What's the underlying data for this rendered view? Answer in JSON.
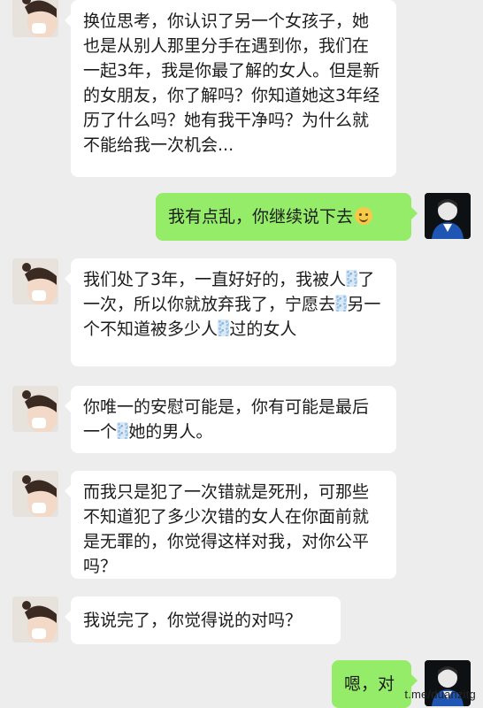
{
  "messages": [
    {
      "sender": "left",
      "segments": [
        "换位思考，你认识了另一个女孩子，她也是从别人那里分手在遇到你，我们在一起3年，我是你最了解的女人。但是新的女朋友，你了解吗？你知道她这3年经历了什么吗？她有我干净吗？为什么就不能给我一次机会..."
      ]
    },
    {
      "sender": "right",
      "segments": [
        "我有点乱，你继续说下去"
      ],
      "emoji": "smile-emoji"
    },
    {
      "sender": "left",
      "segments": [
        "我们处了3年，一直好好的，我被人",
        "了一次，所以你就放弃我了，宁愿去",
        "另一个不知道被多少人",
        "过的女人"
      ]
    },
    {
      "sender": "left",
      "segments": [
        "你唯一的安慰可能是，你有可能是最后一个",
        "她的男人。"
      ]
    },
    {
      "sender": "left",
      "segments": [
        "而我只是犯了一次错就是死刑，可那些不知道犯了多少次错的女人在你面前就是无罪的，你觉得这样对我，对你公平吗？"
      ]
    },
    {
      "sender": "left",
      "segments": [
        "我说完了，你觉得说的对吗？"
      ]
    },
    {
      "sender": "right",
      "segments": [
        "嗯，对"
      ]
    }
  ],
  "watermark": "t.me/duanzitg",
  "colors": {
    "background": "#ededed",
    "incoming": "#ffffff",
    "outgoing": "#95ec69"
  }
}
